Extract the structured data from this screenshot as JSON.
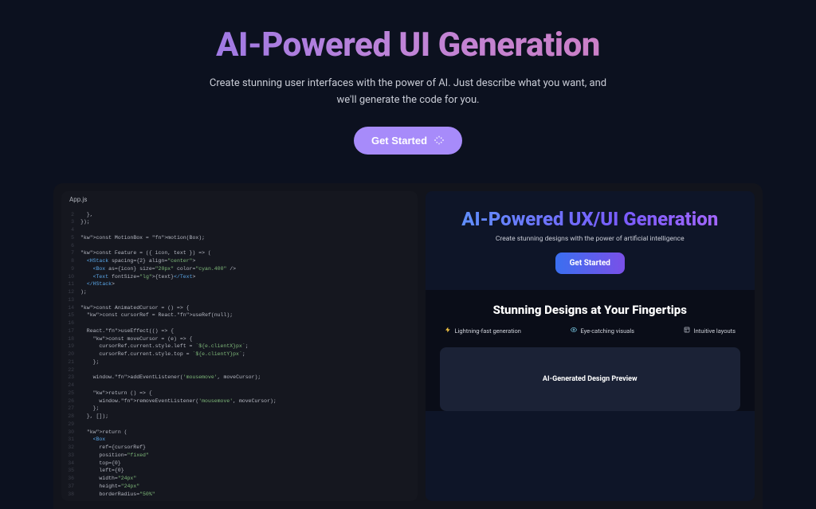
{
  "hero": {
    "title": "AI-Powered UI Generation",
    "subtitle": "Create stunning user interfaces with the power of AI. Just describe what you want, and we'll generate the code for you.",
    "cta_label": "Get Started"
  },
  "code_pane": {
    "filename": "App.js",
    "lines": [
      {
        "n": "2",
        "raw": "  },"
      },
      {
        "n": "3",
        "raw": "});"
      },
      {
        "n": "4",
        "raw": ""
      },
      {
        "n": "5",
        "raw": "const MotionBox = motion(Box);"
      },
      {
        "n": "6",
        "raw": ""
      },
      {
        "n": "7",
        "raw": "const Feature = ({ icon, text }) => ("
      },
      {
        "n": "8",
        "raw": "  <HStack spacing={2} align=\"center\">"
      },
      {
        "n": "9",
        "raw": "    <Box as={icon} size=\"20px\" color=\"cyan.400\" />"
      },
      {
        "n": "10",
        "raw": "    <Text fontSize=\"lg\">{text}</Text>"
      },
      {
        "n": "11",
        "raw": "  </HStack>"
      },
      {
        "n": "12",
        "raw": ");"
      },
      {
        "n": "13",
        "raw": ""
      },
      {
        "n": "14",
        "raw": "const AnimatedCursor = () => {"
      },
      {
        "n": "15",
        "raw": "  const cursorRef = React.useRef(null);"
      },
      {
        "n": "16",
        "raw": ""
      },
      {
        "n": "17",
        "raw": "  React.useEffect(() => {"
      },
      {
        "n": "18",
        "raw": "    const moveCursor = (e) => {"
      },
      {
        "n": "19",
        "raw": "      cursorRef.current.style.left = `${e.clientX}px`;"
      },
      {
        "n": "20",
        "raw": "      cursorRef.current.style.top = `${e.clientY}px`;"
      },
      {
        "n": "21",
        "raw": "    };"
      },
      {
        "n": "22",
        "raw": ""
      },
      {
        "n": "23",
        "raw": "    window.addEventListener('mousemove', moveCursor);"
      },
      {
        "n": "24",
        "raw": ""
      },
      {
        "n": "25",
        "raw": "    return () => {"
      },
      {
        "n": "26",
        "raw": "      window.removeEventListener('mousemove', moveCursor);"
      },
      {
        "n": "27",
        "raw": "    };"
      },
      {
        "n": "28",
        "raw": "  }, []);"
      },
      {
        "n": "29",
        "raw": ""
      },
      {
        "n": "30",
        "raw": "  return ("
      },
      {
        "n": "31",
        "raw": "    <Box"
      },
      {
        "n": "32",
        "raw": "      ref={cursorRef}"
      },
      {
        "n": "33",
        "raw": "      position=\"fixed\""
      },
      {
        "n": "34",
        "raw": "      top={0}"
      },
      {
        "n": "35",
        "raw": "      left={0}"
      },
      {
        "n": "36",
        "raw": "      width=\"24px\""
      },
      {
        "n": "37",
        "raw": "      height=\"24px\""
      },
      {
        "n": "38",
        "raw": "      borderRadius=\"50%\""
      }
    ]
  },
  "render_pane": {
    "title": "AI-Powered UX/UI Generation",
    "subtitle": "Create stunning designs with the power of artificial intelligence",
    "cta": "Get Started",
    "section_title": "Stunning Designs at Your Fingertips",
    "features": [
      {
        "icon": "bolt",
        "label": "Lightning-fast generation"
      },
      {
        "icon": "eye",
        "label": "Eye-catching visuals"
      },
      {
        "icon": "layout",
        "label": "Intuitive layouts"
      }
    ],
    "preview_label": "AI-Generated Design Preview"
  }
}
